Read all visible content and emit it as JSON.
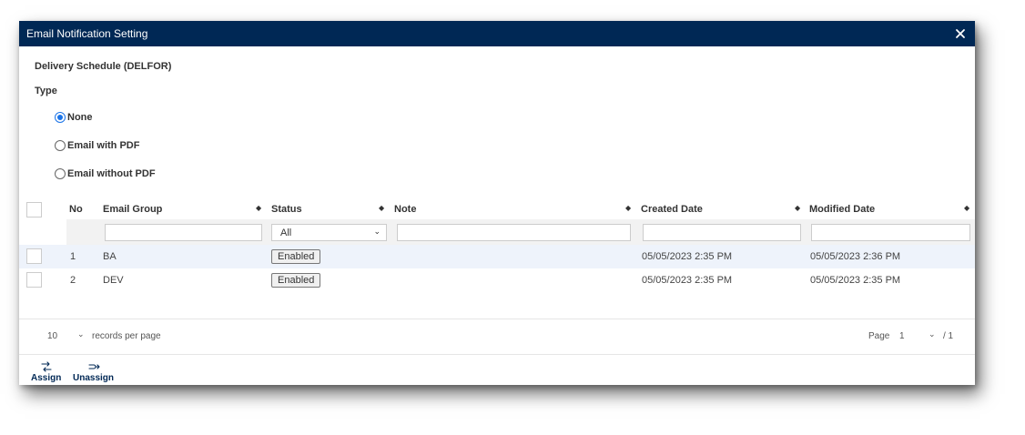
{
  "dialog": {
    "title": "Email Notification Setting",
    "section_title": "Delivery Schedule (DELFOR)",
    "type_label": "Type",
    "options": [
      {
        "label": "None",
        "checked": true
      },
      {
        "label": "Email with PDF",
        "checked": false
      },
      {
        "label": "Email without PDF",
        "checked": false
      }
    ]
  },
  "table": {
    "columns": [
      "No",
      "Email Group",
      "Status",
      "Note",
      "Created Date",
      "Modified Date"
    ],
    "status_filter": "All",
    "rows": [
      {
        "no": "1",
        "group": "BA",
        "status": "Enabled",
        "note": "",
        "created": "05/05/2023 2:35 PM",
        "modified": "05/05/2023 2:36 PM"
      },
      {
        "no": "2",
        "group": "DEV",
        "status": "Enabled",
        "note": "",
        "created": "05/05/2023 2:35 PM",
        "modified": "05/05/2023 2:35 PM"
      }
    ]
  },
  "pager": {
    "page_size": "10",
    "records_label": "records per page",
    "page_label": "Page",
    "page": "1",
    "total": "/ 1"
  },
  "toolbar": {
    "assign": "Assign",
    "unassign": "Unassign"
  },
  "colors": {
    "titlebar": "#002855",
    "accent": "#1a73e8",
    "row_alt": "#eef3fb"
  }
}
